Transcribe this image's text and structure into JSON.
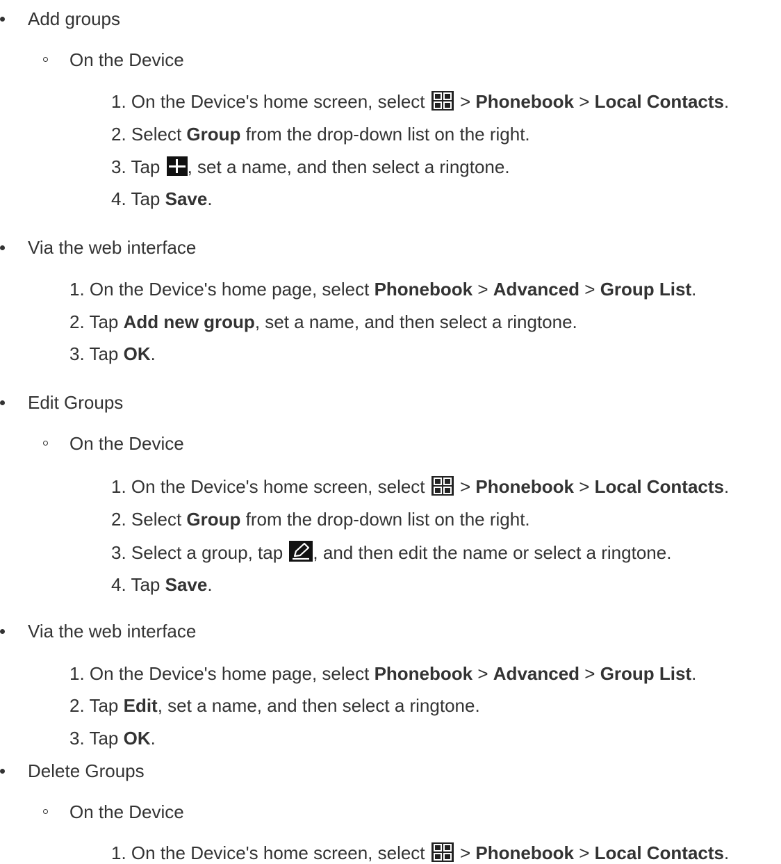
{
  "sections": [
    {
      "title": "Add groups",
      "device_label": "On the Device",
      "device_steps": [
        {
          "num": "1.",
          "pre": "On the Device's home screen, select",
          "icon": "grid-menu-icon",
          "sep1": ">",
          "b1": "Phonebook",
          "sep2": ">",
          "b2": "Local Contacts",
          "post": "."
        },
        {
          "num": "2.",
          "pre": "Select",
          "b1": "Group",
          "post": "from the drop-down list on the right."
        },
        {
          "num": "3.",
          "pre": "Tap",
          "icon": "add-icon",
          "post": ", set a name, and then select a ringtone."
        },
        {
          "num": "4.",
          "pre": "Tap",
          "b1": "Save",
          "post": "."
        }
      ],
      "web_label": "Via the web interface",
      "web_steps": [
        {
          "num": "1.",
          "pre": "On the Device's home page, select",
          "b1": "Phonebook",
          "sep1": ">",
          "b2": "Advanced",
          "sep2": ">",
          "b3": "Group List",
          "post": "."
        },
        {
          "num": "2.",
          "pre": "Tap",
          "b1": "Add new group",
          "post": ", set a name, and then select a ringtone."
        },
        {
          "num": "3.",
          "pre": "Tap",
          "b1": "OK",
          "post": "."
        }
      ]
    },
    {
      "title": "Edit Groups",
      "device_label": "On the Device",
      "device_steps": [
        {
          "num": "1.",
          "pre": "On the Device's home screen, select",
          "icon": "grid-menu-icon",
          "sep1": ">",
          "b1": "Phonebook",
          "sep2": ">",
          "b2": "Local Contacts",
          "post": "."
        },
        {
          "num": "2.",
          "pre": "Select",
          "b1": "Group",
          "post": "from the drop-down list on the right."
        },
        {
          "num": "3.",
          "pre": "Select a group, tap",
          "icon": "edit-icon",
          "post": ", and then edit the name or select a ringtone."
        },
        {
          "num": "4.",
          "pre": "Tap",
          "b1": "Save",
          "post": "."
        }
      ],
      "web_label": "Via the web interface",
      "web_steps": [
        {
          "num": "1.",
          "pre": "On the Device's home page, select",
          "b1": "Phonebook",
          "sep1": ">",
          "b2": "Advanced",
          "sep2": ">",
          "b3": "Group List",
          "post": "."
        },
        {
          "num": "2.",
          "pre": "Tap",
          "b1": "Edit",
          "post": ", set a name, and then select a ringtone."
        },
        {
          "num": "3.",
          "pre": "Tap",
          "b1": "OK",
          "post": "."
        }
      ]
    },
    {
      "title": "Delete Groups",
      "device_label": "On the Device",
      "device_steps": [
        {
          "num": "1.",
          "pre": "On the Device's home screen, select",
          "icon": "grid-menu-icon",
          "sep1": ">",
          "b1": "Phonebook",
          "sep2": ">",
          "b2": "Local Contacts",
          "post": "."
        }
      ]
    }
  ]
}
